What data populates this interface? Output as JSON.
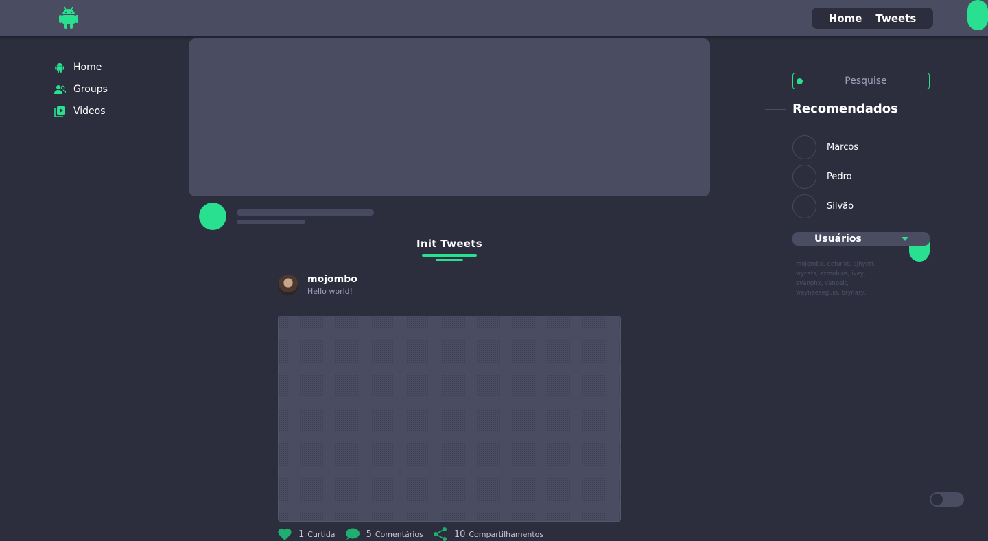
{
  "header": {
    "logo_icon": "android-icon",
    "nav": [
      {
        "label": "Home"
      },
      {
        "label": "Tweets"
      }
    ]
  },
  "sidebar": {
    "items": [
      {
        "label": "Home",
        "icon": "android-icon"
      },
      {
        "label": "Groups",
        "icon": "users-icon"
      },
      {
        "label": "Videos",
        "icon": "video-library-icon"
      }
    ]
  },
  "main": {
    "section_title": "Init Tweets",
    "tweet": {
      "user": "mojombo",
      "text": "Hello world!",
      "actions": [
        {
          "count": "1",
          "label": "Curtida",
          "icon": "heart-icon"
        },
        {
          "count": "5",
          "label": "Comentários",
          "icon": "comment-icon"
        },
        {
          "count": "10",
          "label": "Compartilhamentos",
          "icon": "share-icon"
        }
      ]
    }
  },
  "right": {
    "search_placeholder": "Pesquise",
    "recommended_title": "Recomendados",
    "recommended": [
      "Marcos",
      "Pedro",
      "Silvão"
    ],
    "users_label": "Usuários",
    "users_list": "mojombo, defunkt, pjhyett, wycats, ezmobius, ivey, evanphx, vanpelt, wayneeseguin, brynary, kevinclark, technoweenie"
  },
  "colors": {
    "accent": "#28e08f",
    "background": "#2c2e3e",
    "surface": "#4a4c62"
  }
}
